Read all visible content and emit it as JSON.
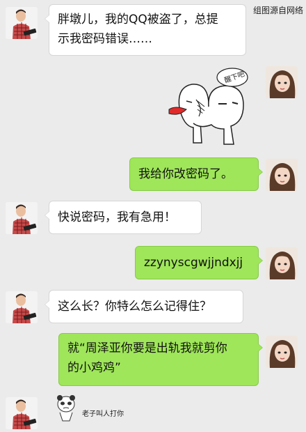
{
  "watermark": "组图源自网络",
  "messages": [
    {
      "side": "left",
      "lines": [
        "胖墩儿，我的QQ被盗了，总提",
        "示我密码错误……"
      ]
    },
    {
      "side": "right",
      "type": "sticker",
      "sticker_text": "醒下吧"
    },
    {
      "side": "right",
      "lines": [
        "我给你改密码了。"
      ]
    },
    {
      "side": "left",
      "lines": [
        "快说密码，我有急用！"
      ]
    },
    {
      "side": "right",
      "lines": [
        "zzynyscgwjjndxjj"
      ]
    },
    {
      "side": "left",
      "lines": [
        "这么长？你特么怎么记得住？"
      ]
    },
    {
      "side": "right",
      "lines": [
        "就“周泽亚你要是出轨我就剪你",
        "的小鸡鸡”"
      ]
    },
    {
      "side": "left",
      "type": "sticker",
      "sticker_text": "老子叫人打你"
    }
  ],
  "icons": {
    "male_avatar": "male-avatar",
    "female_avatar": "female-avatar"
  }
}
